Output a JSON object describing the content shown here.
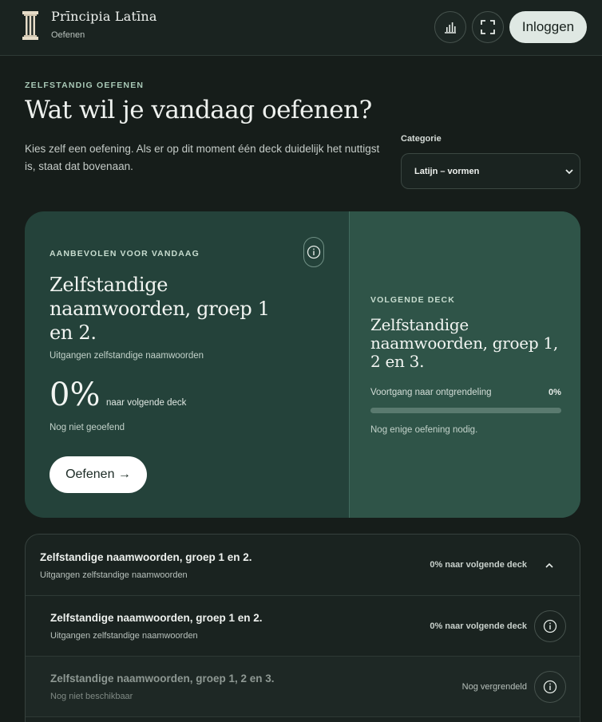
{
  "header": {
    "app_name": "Prīncipia Latīna",
    "section": "Oefenen",
    "login_label": "Inloggen",
    "icons": [
      "column-pillar-logo",
      "bar-chart-icon",
      "fullscreen-icon"
    ]
  },
  "intro": {
    "eyebrow": "ZELFSTANDIG OEFENEN",
    "title": "Wat wil je vandaag oefenen?",
    "description": "Kies zelf een oefening. Als er op dit moment één deck duidelijk het nuttigst is, staat dat bovenaan."
  },
  "category": {
    "label": "Categorie",
    "selected": "Latijn – vormen"
  },
  "recommended": {
    "eyebrow": "AANBEVOLEN VOOR VANDAAG",
    "title": "Zelfstandige naamwoorden, groep 1 en 2.",
    "subtitle": "Uitgangen zelfstandige naamwoorden",
    "percent": "0%",
    "percent_label": "naar volgende deck",
    "status": "Nog niet geoefend",
    "button_label": "Oefenen →"
  },
  "next_deck": {
    "eyebrow": "VOLGENDE DECK",
    "title": "Zelfstandige naamwoorden, groep 1, 2 en 3.",
    "progress_label": "Voortgang naar ontgrendeling",
    "progress_value": "0%",
    "progress_fraction": 0,
    "note": "Nog enige oefening nodig."
  },
  "deck_list": {
    "group": {
      "title": "Zelfstandige naamwoorden, groep 1 en 2.",
      "subtitle": "Uitgangen zelfstandige naamwoorden",
      "meta": "0% naar volgende deck"
    },
    "rows": [
      {
        "title": "Zelfstandige naamwoorden, groep 1 en 2.",
        "subtitle": "Uitgangen zelfstandige naamwoorden",
        "meta": "0% naar volgende deck"
      },
      {
        "title": "Zelfstandige naamwoorden, groep 1, 2 en 3.",
        "subtitle": "Nog niet beschikbaar",
        "meta": "Nog vergrendeld"
      }
    ]
  },
  "colors": {
    "background": "#161d1a",
    "card_dark": "#24423a",
    "card_light": "#2f5448",
    "accent": "#a9c9b7"
  }
}
